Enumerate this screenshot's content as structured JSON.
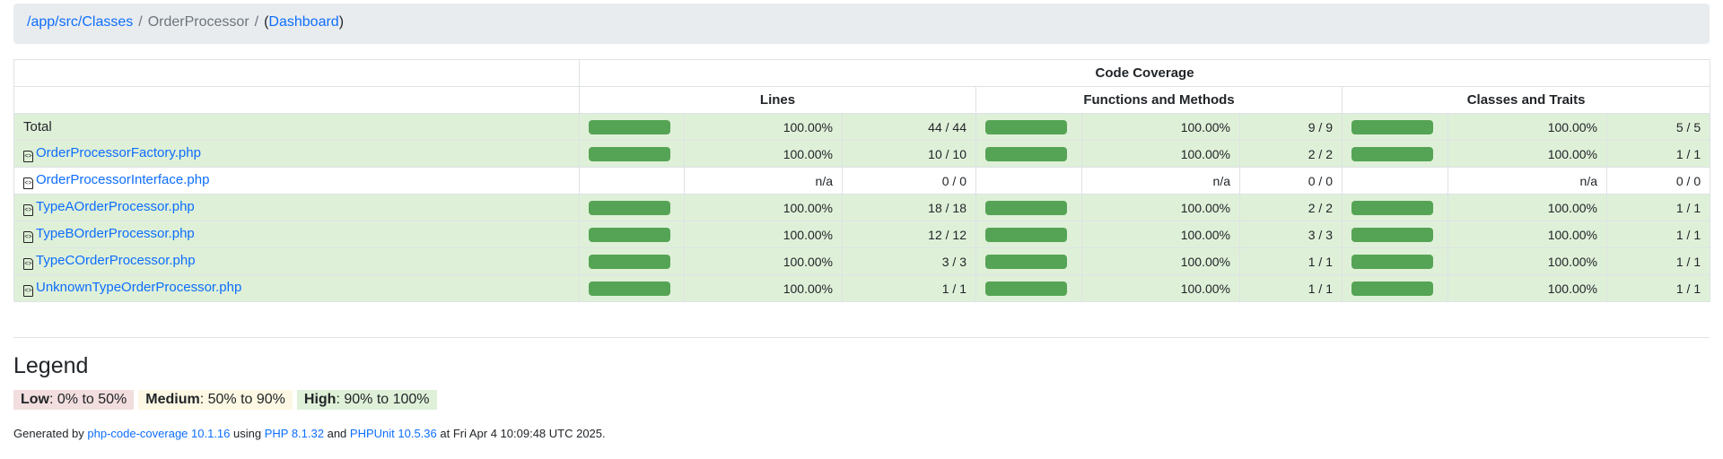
{
  "breadcrumb": {
    "path": "/app/src/Classes",
    "current": "OrderProcessor",
    "dashboard": "Dashboard",
    "sep": "/",
    "open": "(",
    "close": ")"
  },
  "table": {
    "header_group": "Code Coverage",
    "columns": [
      "Lines",
      "Functions and Methods",
      "Classes and Traits"
    ],
    "rows": [
      {
        "name": "Total",
        "is_file": false,
        "high": true,
        "lines": {
          "pct": "100.00%",
          "count": "44 / 44",
          "fill": 100
        },
        "funcs": {
          "pct": "100.00%",
          "count": "9 / 9",
          "fill": 100
        },
        "classes": {
          "pct": "100.00%",
          "count": "5 / 5",
          "fill": 100
        }
      },
      {
        "name": "OrderProcessorFactory.php",
        "is_file": true,
        "high": true,
        "lines": {
          "pct": "100.00%",
          "count": "10 / 10",
          "fill": 100
        },
        "funcs": {
          "pct": "100.00%",
          "count": "2 / 2",
          "fill": 100
        },
        "classes": {
          "pct": "100.00%",
          "count": "1 / 1",
          "fill": 100
        }
      },
      {
        "name": "OrderProcessorInterface.php",
        "is_file": true,
        "high": false,
        "lines": {
          "pct": "n/a",
          "count": "0 / 0",
          "fill": null
        },
        "funcs": {
          "pct": "n/a",
          "count": "0 / 0",
          "fill": null
        },
        "classes": {
          "pct": "n/a",
          "count": "0 / 0",
          "fill": null
        }
      },
      {
        "name": "TypeAOrderProcessor.php",
        "is_file": true,
        "high": true,
        "lines": {
          "pct": "100.00%",
          "count": "18 / 18",
          "fill": 100
        },
        "funcs": {
          "pct": "100.00%",
          "count": "2 / 2",
          "fill": 100
        },
        "classes": {
          "pct": "100.00%",
          "count": "1 / 1",
          "fill": 100
        }
      },
      {
        "name": "TypeBOrderProcessor.php",
        "is_file": true,
        "high": true,
        "lines": {
          "pct": "100.00%",
          "count": "12 / 12",
          "fill": 100
        },
        "funcs": {
          "pct": "100.00%",
          "count": "3 / 3",
          "fill": 100
        },
        "classes": {
          "pct": "100.00%",
          "count": "1 / 1",
          "fill": 100
        }
      },
      {
        "name": "TypeCOrderProcessor.php",
        "is_file": true,
        "high": true,
        "lines": {
          "pct": "100.00%",
          "count": "3 / 3",
          "fill": 100
        },
        "funcs": {
          "pct": "100.00%",
          "count": "1 / 1",
          "fill": 100
        },
        "classes": {
          "pct": "100.00%",
          "count": "1 / 1",
          "fill": 100
        }
      },
      {
        "name": "UnknownTypeOrderProcessor.php",
        "is_file": true,
        "high": true,
        "lines": {
          "pct": "100.00%",
          "count": "1 / 1",
          "fill": 100
        },
        "funcs": {
          "pct": "100.00%",
          "count": "1 / 1",
          "fill": 100
        },
        "classes": {
          "pct": "100.00%",
          "count": "1 / 1",
          "fill": 100
        }
      }
    ]
  },
  "legend": {
    "title": "Legend",
    "items": [
      {
        "label": "Low",
        "range": ": 0% to 50%"
      },
      {
        "label": "Medium",
        "range": ": 50% to 90%"
      },
      {
        "label": "High",
        "range": ": 90% to 100%"
      }
    ]
  },
  "footer": {
    "t1": "Generated by ",
    "l1": "php-code-coverage 10.1.16",
    "t2": " using ",
    "l2": "PHP 8.1.32",
    "t3": " and ",
    "l3": "PHPUnit 10.5.36",
    "t4": " at Fri Apr 4 10:09:48 UTC 2025."
  },
  "colors": {
    "bar": "#55a455",
    "high_bg": "#dff0d8",
    "low_bg": "#f2dede",
    "medium_bg": "#fcf8e3",
    "link": "#0d6efd"
  }
}
